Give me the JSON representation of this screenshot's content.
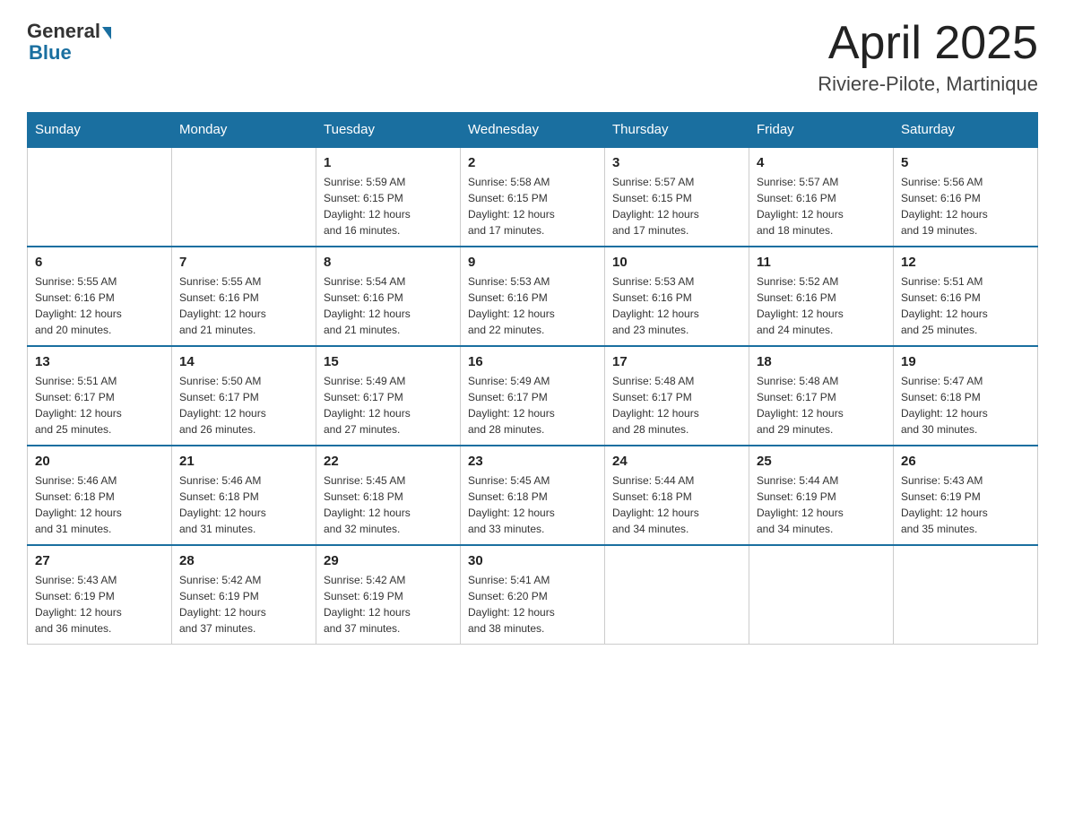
{
  "header": {
    "logo_general": "General",
    "logo_blue": "Blue",
    "month": "April 2025",
    "location": "Riviere-Pilote, Martinique"
  },
  "weekdays": [
    "Sunday",
    "Monday",
    "Tuesday",
    "Wednesday",
    "Thursday",
    "Friday",
    "Saturday"
  ],
  "weeks": [
    [
      {
        "day": "",
        "info": ""
      },
      {
        "day": "",
        "info": ""
      },
      {
        "day": "1",
        "info": "Sunrise: 5:59 AM\nSunset: 6:15 PM\nDaylight: 12 hours\nand 16 minutes."
      },
      {
        "day": "2",
        "info": "Sunrise: 5:58 AM\nSunset: 6:15 PM\nDaylight: 12 hours\nand 17 minutes."
      },
      {
        "day": "3",
        "info": "Sunrise: 5:57 AM\nSunset: 6:15 PM\nDaylight: 12 hours\nand 17 minutes."
      },
      {
        "day": "4",
        "info": "Sunrise: 5:57 AM\nSunset: 6:16 PM\nDaylight: 12 hours\nand 18 minutes."
      },
      {
        "day": "5",
        "info": "Sunrise: 5:56 AM\nSunset: 6:16 PM\nDaylight: 12 hours\nand 19 minutes."
      }
    ],
    [
      {
        "day": "6",
        "info": "Sunrise: 5:55 AM\nSunset: 6:16 PM\nDaylight: 12 hours\nand 20 minutes."
      },
      {
        "day": "7",
        "info": "Sunrise: 5:55 AM\nSunset: 6:16 PM\nDaylight: 12 hours\nand 21 minutes."
      },
      {
        "day": "8",
        "info": "Sunrise: 5:54 AM\nSunset: 6:16 PM\nDaylight: 12 hours\nand 21 minutes."
      },
      {
        "day": "9",
        "info": "Sunrise: 5:53 AM\nSunset: 6:16 PM\nDaylight: 12 hours\nand 22 minutes."
      },
      {
        "day": "10",
        "info": "Sunrise: 5:53 AM\nSunset: 6:16 PM\nDaylight: 12 hours\nand 23 minutes."
      },
      {
        "day": "11",
        "info": "Sunrise: 5:52 AM\nSunset: 6:16 PM\nDaylight: 12 hours\nand 24 minutes."
      },
      {
        "day": "12",
        "info": "Sunrise: 5:51 AM\nSunset: 6:16 PM\nDaylight: 12 hours\nand 25 minutes."
      }
    ],
    [
      {
        "day": "13",
        "info": "Sunrise: 5:51 AM\nSunset: 6:17 PM\nDaylight: 12 hours\nand 25 minutes."
      },
      {
        "day": "14",
        "info": "Sunrise: 5:50 AM\nSunset: 6:17 PM\nDaylight: 12 hours\nand 26 minutes."
      },
      {
        "day": "15",
        "info": "Sunrise: 5:49 AM\nSunset: 6:17 PM\nDaylight: 12 hours\nand 27 minutes."
      },
      {
        "day": "16",
        "info": "Sunrise: 5:49 AM\nSunset: 6:17 PM\nDaylight: 12 hours\nand 28 minutes."
      },
      {
        "day": "17",
        "info": "Sunrise: 5:48 AM\nSunset: 6:17 PM\nDaylight: 12 hours\nand 28 minutes."
      },
      {
        "day": "18",
        "info": "Sunrise: 5:48 AM\nSunset: 6:17 PM\nDaylight: 12 hours\nand 29 minutes."
      },
      {
        "day": "19",
        "info": "Sunrise: 5:47 AM\nSunset: 6:18 PM\nDaylight: 12 hours\nand 30 minutes."
      }
    ],
    [
      {
        "day": "20",
        "info": "Sunrise: 5:46 AM\nSunset: 6:18 PM\nDaylight: 12 hours\nand 31 minutes."
      },
      {
        "day": "21",
        "info": "Sunrise: 5:46 AM\nSunset: 6:18 PM\nDaylight: 12 hours\nand 31 minutes."
      },
      {
        "day": "22",
        "info": "Sunrise: 5:45 AM\nSunset: 6:18 PM\nDaylight: 12 hours\nand 32 minutes."
      },
      {
        "day": "23",
        "info": "Sunrise: 5:45 AM\nSunset: 6:18 PM\nDaylight: 12 hours\nand 33 minutes."
      },
      {
        "day": "24",
        "info": "Sunrise: 5:44 AM\nSunset: 6:18 PM\nDaylight: 12 hours\nand 34 minutes."
      },
      {
        "day": "25",
        "info": "Sunrise: 5:44 AM\nSunset: 6:19 PM\nDaylight: 12 hours\nand 34 minutes."
      },
      {
        "day": "26",
        "info": "Sunrise: 5:43 AM\nSunset: 6:19 PM\nDaylight: 12 hours\nand 35 minutes."
      }
    ],
    [
      {
        "day": "27",
        "info": "Sunrise: 5:43 AM\nSunset: 6:19 PM\nDaylight: 12 hours\nand 36 minutes."
      },
      {
        "day": "28",
        "info": "Sunrise: 5:42 AM\nSunset: 6:19 PM\nDaylight: 12 hours\nand 37 minutes."
      },
      {
        "day": "29",
        "info": "Sunrise: 5:42 AM\nSunset: 6:19 PM\nDaylight: 12 hours\nand 37 minutes."
      },
      {
        "day": "30",
        "info": "Sunrise: 5:41 AM\nSunset: 6:20 PM\nDaylight: 12 hours\nand 38 minutes."
      },
      {
        "day": "",
        "info": ""
      },
      {
        "day": "",
        "info": ""
      },
      {
        "day": "",
        "info": ""
      }
    ]
  ]
}
